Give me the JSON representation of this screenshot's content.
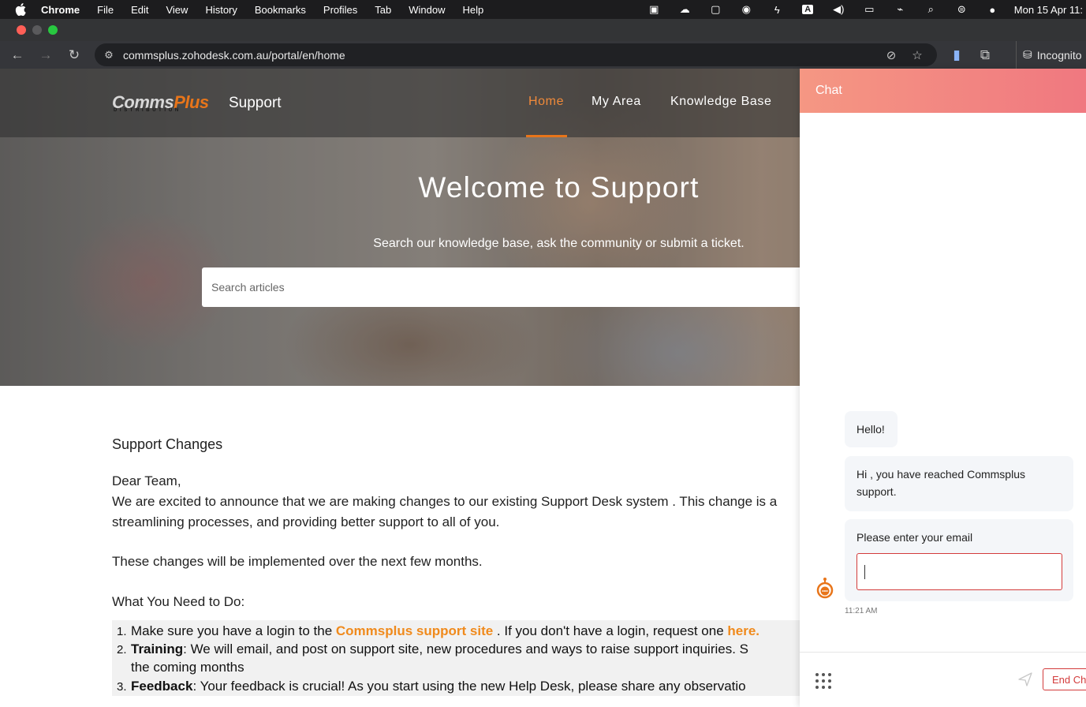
{
  "menubar": {
    "items": [
      "Chrome",
      "File",
      "Edit",
      "View",
      "History",
      "Bookmarks",
      "Profiles",
      "Tab",
      "Window",
      "Help"
    ],
    "clock": "Mon 15 Apr  11:"
  },
  "browser": {
    "url": "commsplus.zohodesk.com.au/portal/en/home",
    "incognito_label": "Incognito"
  },
  "site": {
    "logo_main": "Comms",
    "logo_accent": "Plus",
    "logo_sub": "DISTRIBUTION",
    "brand_word": "Support",
    "nav": [
      "Home",
      "My Area",
      "Knowledge Base"
    ],
    "accent_color": "#e8751a"
  },
  "hero": {
    "title": "Welcome to Support",
    "subtitle": "Search our knowledge base, ask the community or submit a ticket.",
    "search_placeholder": "Search articles"
  },
  "article": {
    "title": "Support Changes",
    "greeting": "Dear Team,",
    "line1": "We are excited to announce that we are making changes to our existing Support Desk system . This change is a",
    "line2": "streamlining processes, and providing better support to all of you.",
    "line3": "These changes will be implemented over the next few months.",
    "todo_heading": "What You Need to Do:",
    "steps": [
      {
        "num": "1.",
        "pre": "Make sure you have a login to the ",
        "link": "Commsplus support site",
        "mid": " . If you don't have a login, request one ",
        "link2": "here."
      },
      {
        "num": "2.",
        "bold": "Training",
        "text": ": We will email, and post on support site, new procedures and ways to raise support inquiries. S",
        "text2": "the coming months"
      },
      {
        "num": "3.",
        "bold": "Feedback",
        "text": ": Your feedback is crucial! As you start using the new Help Desk, please share any observatio"
      }
    ]
  },
  "chat": {
    "title": "Chat",
    "messages": [
      "Hello!",
      "Hi , you have reached Commsplus support."
    ],
    "prompt": "Please enter your email",
    "timestamp": "11:21 AM",
    "end_button": "End Ch",
    "header_colors": [
      "#f59783",
      "#f07880"
    ],
    "error_color": "#d33b3b"
  }
}
